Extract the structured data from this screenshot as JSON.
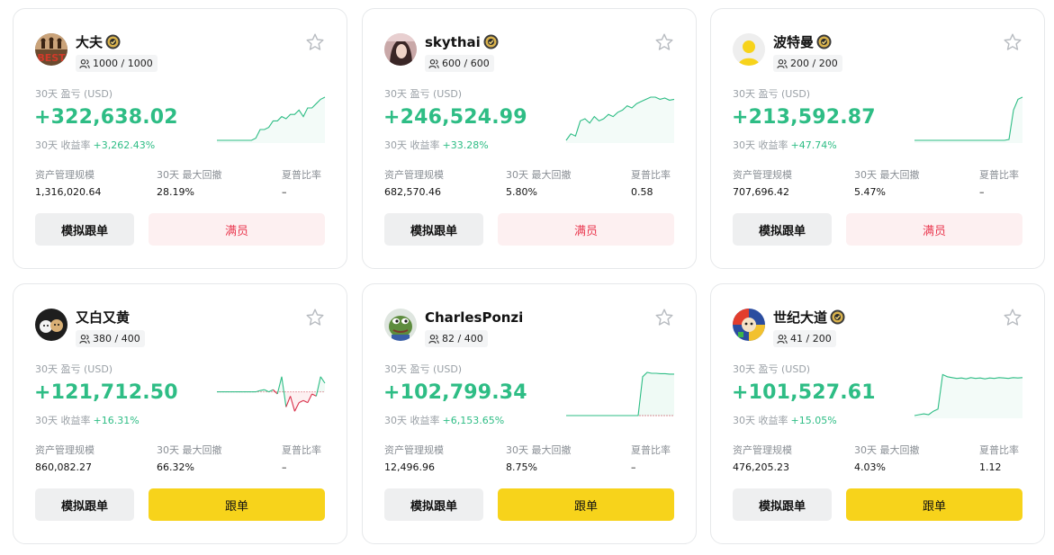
{
  "cards": [
    {
      "name": "大夫",
      "has_badge": true,
      "copiers": "1000 / 1000",
      "pnl_label": "30天 盈亏 (USD)",
      "pnl": "+322,638.02",
      "roi_label": "30天 收益率",
      "roi": "+3,262.43%",
      "aum_label": "资产管理规模",
      "aum": "1,316,020.64",
      "mdd_label": "30天 最大回撤",
      "mdd": "28.19%",
      "sharpe_label": "夏普比率",
      "sharpe": "–",
      "sim_label": "模拟跟单",
      "action_label": "满员",
      "action_state": "full",
      "avatar": "best-logo-avatar",
      "spark": [
        0,
        0,
        0,
        0,
        0,
        0,
        0,
        0,
        0,
        0.05,
        0.25,
        0.25,
        0.3,
        0.45,
        0.45,
        0.55,
        0.5,
        0.6,
        0.6,
        0.7,
        0.55,
        0.75,
        0.75,
        0.85,
        0.95,
        1
      ],
      "spark_color": "#2ebd85"
    },
    {
      "name": "skythai",
      "has_badge": true,
      "copiers": "600 / 600",
      "pnl_label": "30天 盈亏 (USD)",
      "pnl": "+246,524.99",
      "roi_label": "30天 收益率",
      "roi": "+33.28%",
      "aum_label": "资产管理规模",
      "aum": "682,570.46",
      "mdd_label": "30天 最大回撤",
      "mdd": "5.80%",
      "sharpe_label": "夏普比率",
      "sharpe": "0.58",
      "sim_label": "模拟跟单",
      "action_label": "满员",
      "action_state": "full",
      "avatar": "photo-avatar",
      "spark": [
        0,
        0.15,
        0.1,
        0.45,
        0.5,
        0.4,
        0.55,
        0.45,
        0.5,
        0.6,
        0.55,
        0.65,
        0.7,
        0.8,
        0.75,
        0.85,
        0.9,
        0.95,
        1,
        1,
        0.95,
        0.98,
        0.93,
        0.95
      ],
      "spark_color": "#2ebd85"
    },
    {
      "name": "波特曼",
      "has_badge": true,
      "copiers": "200 / 200",
      "pnl_label": "30天 盈亏 (USD)",
      "pnl": "+213,592.87",
      "roi_label": "30天 收益率",
      "roi": "+47.74%",
      "aum_label": "资产管理规模",
      "aum": "707,696.42",
      "mdd_label": "30天 最大回撤",
      "mdd": "5.47%",
      "sharpe_label": "夏普比率",
      "sharpe": "–",
      "sim_label": "模拟跟单",
      "action_label": "满员",
      "action_state": "full",
      "avatar": "yellow-default-avatar",
      "spark": [
        0,
        0,
        0,
        0,
        0,
        0,
        0,
        0,
        0,
        0,
        0,
        0,
        0,
        0,
        0,
        0,
        0,
        0,
        0,
        0,
        0,
        0.02,
        0.7,
        0.95,
        1
      ],
      "spark_color": "#2ebd85"
    },
    {
      "name": "又白又黄",
      "has_badge": false,
      "copiers": "380 / 400",
      "pnl_label": "30天 盈亏 (USD)",
      "pnl": "+121,712.50",
      "roi_label": "30天 收益率",
      "roi": "+16.31%",
      "aum_label": "资产管理规模",
      "aum": "860,082.27",
      "mdd_label": "30天 最大回撤",
      "mdd": "66.32%",
      "sharpe_label": "夏普比率",
      "sharpe": "–",
      "sim_label": "模拟跟单",
      "action_label": "跟单",
      "action_state": "copy",
      "avatar": "dogs-avatar",
      "spark": [
        0.55,
        0.55,
        0.55,
        0.55,
        0.55,
        0.55,
        0.55,
        0.55,
        0.55,
        0.55,
        0.58,
        0.6,
        0.55,
        0.6,
        0.5,
        0.9,
        0.2,
        0.45,
        0.1,
        0.3,
        0.35,
        0.3,
        0.5,
        0.45,
        0.9,
        0.75
      ],
      "spark_color": "mixed"
    },
    {
      "name": "CharlesPonzi",
      "has_badge": false,
      "copiers": "82 / 400",
      "pnl_label": "30天 盈亏 (USD)",
      "pnl": "+102,799.34",
      "roi_label": "30天 收益率",
      "roi": "+6,153.65%",
      "aum_label": "资产管理规模",
      "aum": "12,496.96",
      "mdd_label": "30天 最大回撤",
      "mdd": "8.75%",
      "sharpe_label": "夏普比率",
      "sharpe": "–",
      "sim_label": "模拟跟单",
      "action_label": "跟单",
      "action_state": "copy",
      "avatar": "frog-avatar",
      "spark": [
        0,
        0,
        0,
        0,
        0,
        0,
        0,
        0,
        0,
        0,
        0,
        0,
        0,
        0,
        0,
        0,
        0,
        0.9,
        1,
        0.98,
        0.98,
        0.97,
        0.97,
        0.96,
        0.96
      ],
      "spark_color": "mixed-flat"
    },
    {
      "name": "世纪大道",
      "has_badge": true,
      "copiers": "41 / 200",
      "pnl_label": "30天 盈亏 (USD)",
      "pnl": "+101,527.61",
      "roi_label": "30天 收益率",
      "roi": "+15.05%",
      "aum_label": "资产管理规模",
      "aum": "476,205.23",
      "mdd_label": "30天 最大回撤",
      "mdd": "4.03%",
      "sharpe_label": "夏普比率",
      "sharpe": "1.12",
      "sim_label": "模拟跟单",
      "action_label": "跟单",
      "action_state": "copy",
      "avatar": "game-art-avatar",
      "spark": [
        0,
        0.02,
        0.04,
        0.02,
        0.1,
        0.15,
        0.95,
        0.9,
        0.88,
        0.86,
        0.87,
        0.85,
        0.88,
        0.86,
        0.87,
        0.85,
        0.87,
        0.86,
        0.88,
        0.87,
        0.86,
        0.88,
        0.87,
        0.88
      ],
      "spark_color": "#2ebd85"
    }
  ]
}
